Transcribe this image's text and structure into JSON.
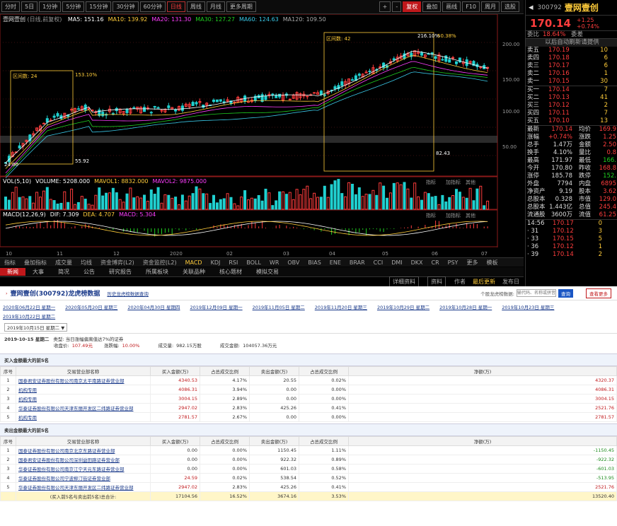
{
  "toolbar": {
    "buttons": [
      "分时",
      "5日",
      "1分钟",
      "5分钟",
      "15分钟",
      "30分钟",
      "60分钟",
      "日线",
      "周线",
      "月线",
      "更多周期"
    ],
    "active": "日线",
    "right_buttons": [
      "+",
      "-",
      "复权",
      "叠加",
      "画线",
      "F10",
      "周月",
      "选股"
    ]
  },
  "chart": {
    "title": "壹网壹创",
    "title_sub": "(日线,前复权)",
    "ma_legend": [
      {
        "label": "MA5: 151.16",
        "color": "#ffffff"
      },
      {
        "label": "MA10: 139.92",
        "color": "#ffcc3a"
      },
      {
        "label": "MA20: 131.30",
        "color": "#ff3dff"
      },
      {
        "label": "MA30: 127.27",
        "color": "#20d020"
      },
      {
        "label": "MA60: 124.63",
        "color": "#3ac9e8"
      },
      {
        "label": "MA120: 109.50",
        "color": "#aaaaaa"
      }
    ],
    "price_axis": [
      "200.00",
      "150.00",
      "100.00",
      "50.00"
    ],
    "box_left": {
      "label": "区间数: 24",
      "pct": "153.10%",
      "low": "24.00",
      "low_box": "55.92"
    },
    "box_right": {
      "label": "区间数: 42",
      "pct": "216.10%",
      "pct2": "50.38%",
      "low": "82.43"
    },
    "time_axis": [
      "10",
      "11",
      "12",
      "2020",
      "02",
      "03",
      "04",
      "05",
      "06",
      "07"
    ],
    "vol_legend": [
      {
        "label": "VOL(5,10)",
        "color": "#ffffff"
      },
      {
        "label": "VOLUME: 5208.000",
        "color": "#ffffff"
      },
      {
        "label": "MAVOL1: 8832.000",
        "color": "#ffcc3a"
      },
      {
        "label": "MAVOL2: 9875.000",
        "color": "#ff3dff"
      }
    ],
    "macd_legend": [
      {
        "label": "MACD(12,26,9)",
        "color": "#ffffff"
      },
      {
        "label": "DIF: 7.309",
        "color": "#ffffff"
      },
      {
        "label": "DEA: 4.707",
        "color": "#ffcc3a"
      },
      {
        "label": "MACD: 5.304",
        "color": "#ff3dff"
      }
    ],
    "sub_btns": [
      "指标",
      "加指标",
      "其他"
    ]
  },
  "indicator_tabs": [
    "指标",
    "叠加指标",
    "成交量",
    "均线",
    "资金博弈(L2)",
    "资金监控(L2)",
    "MACD",
    "KDJ",
    "RSI",
    "BOLL",
    "WR",
    "OBV",
    "BIAS",
    "ENE",
    "BRAR",
    "CCI",
    "DMI",
    "DKX",
    "CR",
    "PSY",
    "更多",
    "模板"
  ],
  "indicator_active": "MACD",
  "f10_tabs": [
    "新闻",
    "大事",
    "简况",
    "公告",
    "研究报告",
    "所属板块",
    "关联品种",
    "核心题材",
    "模拟交易"
  ],
  "f10_active": "新闻",
  "info_bar": {
    "a": "详细资料",
    "b": "资料",
    "c": "作者",
    "d": "最后更新",
    "e": "发布日"
  },
  "quote": {
    "code": "300792",
    "name": "壹网壹创",
    "price": "170.14",
    "change": "+1.25",
    "change_pct": "+0.74%",
    "wb_label": "委比",
    "wb": "18.64%",
    "wc_label": "委差",
    "tag": "以后自动刷新请提供",
    "sells": [
      {
        "l": "卖五",
        "p": "170.19",
        "v": "10"
      },
      {
        "l": "卖四",
        "p": "170.18",
        "v": "6"
      },
      {
        "l": "卖三",
        "p": "170.17",
        "v": "6"
      },
      {
        "l": "卖二",
        "p": "170.16",
        "v": "1"
      },
      {
        "l": "卖一",
        "p": "170.15",
        "v": "30"
      }
    ],
    "buys": [
      {
        "l": "买一",
        "p": "170.14",
        "v": "7"
      },
      {
        "l": "买二",
        "p": "170.13",
        "v": "41"
      },
      {
        "l": "买三",
        "p": "170.12",
        "v": "2"
      },
      {
        "l": "买四",
        "p": "170.11",
        "v": "7"
      },
      {
        "l": "买五",
        "p": "170.10",
        "v": "13"
      }
    ],
    "stats": [
      {
        "a": "最新",
        "b": "170.14",
        "c": "均价",
        "d": "169.9"
      },
      {
        "a": "涨幅",
        "b": "+0.74%",
        "c": "涨跌",
        "d": "1.25"
      },
      {
        "a": "总手",
        "b": "1.47万",
        "c": "金额",
        "d": "2.50"
      },
      {
        "a": "换手",
        "b": "4.10%",
        "c": "量比",
        "d": "0.8"
      },
      {
        "a": "最高",
        "b": "171.97",
        "c": "最低",
        "d": "166."
      },
      {
        "a": "今开",
        "b": "170.80",
        "c": "昨收",
        "d": "168.8"
      },
      {
        "a": "涨停",
        "b": "185.78",
        "c": "跌停",
        "d": "152."
      },
      {
        "a": "外盘",
        "b": "7794",
        "c": "内盘",
        "d": "6895"
      },
      {
        "a": "净资产",
        "b": "9.19",
        "c": "股本",
        "d": "3.62"
      },
      {
        "a": "总股本",
        "b": "0.328",
        "c": "市值",
        "d": "129.0"
      },
      {
        "a": "总股本",
        "b": "1.443亿",
        "c": "总值",
        "d": "245.4"
      },
      {
        "a": "流通股",
        "b": "3600万",
        "c": "流值",
        "d": "61.25"
      }
    ],
    "ticks": [
      {
        "t": "14:56",
        "p": "170.17",
        "v": "0"
      },
      {
        "t": "· 31",
        "p": "170.12",
        "v": "3"
      },
      {
        "t": "· 33",
        "p": "170.15",
        "v": "5"
      },
      {
        "t": "· 36",
        "p": "170.12",
        "v": "1"
      },
      {
        "t": "· 39",
        "p": "170.14",
        "v": "2"
      }
    ]
  },
  "web": {
    "title": "壹网壹创(300792)龙虎榜数据",
    "sub": "历史龙虎榜数据查询",
    "search_label": "个股龙虎榜数据:",
    "search_placeholder": "输代码、名称或拼音",
    "search_btn": "查询",
    "back_btn": "查看更多",
    "dates": [
      "2020年06月22日 星期一",
      "2020年05月20日 星期三",
      "2020年04月30日 星期四",
      "2019年12月09日 星期一",
      "2019年11月05日 星期二",
      "2019年11月20日 星期三",
      "2019年10月29日 星期二",
      "2019年10月28日 星期一",
      "2019年10月23日 星期三",
      "2019年10月22日 星期二"
    ],
    "date_select": "2019年10月15日 星期二 ▼",
    "detail": {
      "date": "2019-10-15 星期二",
      "type": "类型: 当日涨幅偏离值达7%的证券",
      "close_label": "收盘价:",
      "close": "107.49元",
      "chg_label": "涨跌幅:",
      "chg": "10.00%",
      "vol_label": "成交量:",
      "vol": "982.15万股",
      "amt_label": "成交金额:",
      "amt": "104057.36万元"
    },
    "buy_title": "买入金额最大的前5名",
    "sell_title": "卖出金额最大的前5名",
    "headers": [
      "序号",
      "交易营业部名称",
      "买入金额(万)",
      "占总成交比例",
      "卖出金额(万)",
      "占总成交比例",
      "净额(万)"
    ],
    "buy_rows": [
      [
        "1",
        "国泰君安证券股份有限公司南京太平南路证券营业部",
        "4340.53",
        "4.17%",
        "20.55",
        "0.02%",
        "4320.37"
      ],
      [
        "2",
        "机构专用",
        "4086.31",
        "3.94%",
        "0.00",
        "0.00%",
        "4086.31"
      ],
      [
        "3",
        "机构专用",
        "3004.15",
        "2.89%",
        "0.00",
        "0.00%",
        "3004.15"
      ],
      [
        "4",
        "华泰证券股份有限公司天津东丽开发区二纬路证券营业部",
        "2947.02",
        "2.83%",
        "425.26",
        "0.41%",
        "2521.76"
      ],
      [
        "5",
        "机构专用",
        "2781.57",
        "2.67%",
        "0.00",
        "0.00%",
        "2781.57"
      ]
    ],
    "sell_rows": [
      [
        "1",
        "国泰证券股份有限公司南京北京东路证券营业部",
        "0.00",
        "0.00%",
        "1150.45",
        "1.11%",
        "-1150.45"
      ],
      [
        "2",
        "国泰君安证券股份有限公司深圳益田路证券营业部",
        "0.00",
        "0.00%",
        "922.32",
        "0.89%",
        "-922.32"
      ],
      [
        "3",
        "华泰证券股份有限公司南京江宁天元东路证券营业部",
        "0.00",
        "0.00%",
        "601.03",
        "0.58%",
        "-601.03"
      ],
      [
        "4",
        "华泰证券股份有限公司宁波柳汀街证券营业部",
        "24.59",
        "0.02%",
        "538.54",
        "0.52%",
        "-513.95"
      ],
      [
        "5",
        "华泰证券股份有限公司天津东丽开发区二纬路证券营业部",
        "2947.02",
        "2.83%",
        "425.26",
        "0.41%",
        "2521.76"
      ]
    ],
    "sum_row": [
      "",
      "(买入前5名与卖出前5名)总合计:",
      "17104.56",
      "16.52%",
      "3674.16",
      "3.53%",
      "13520.40"
    ]
  }
}
